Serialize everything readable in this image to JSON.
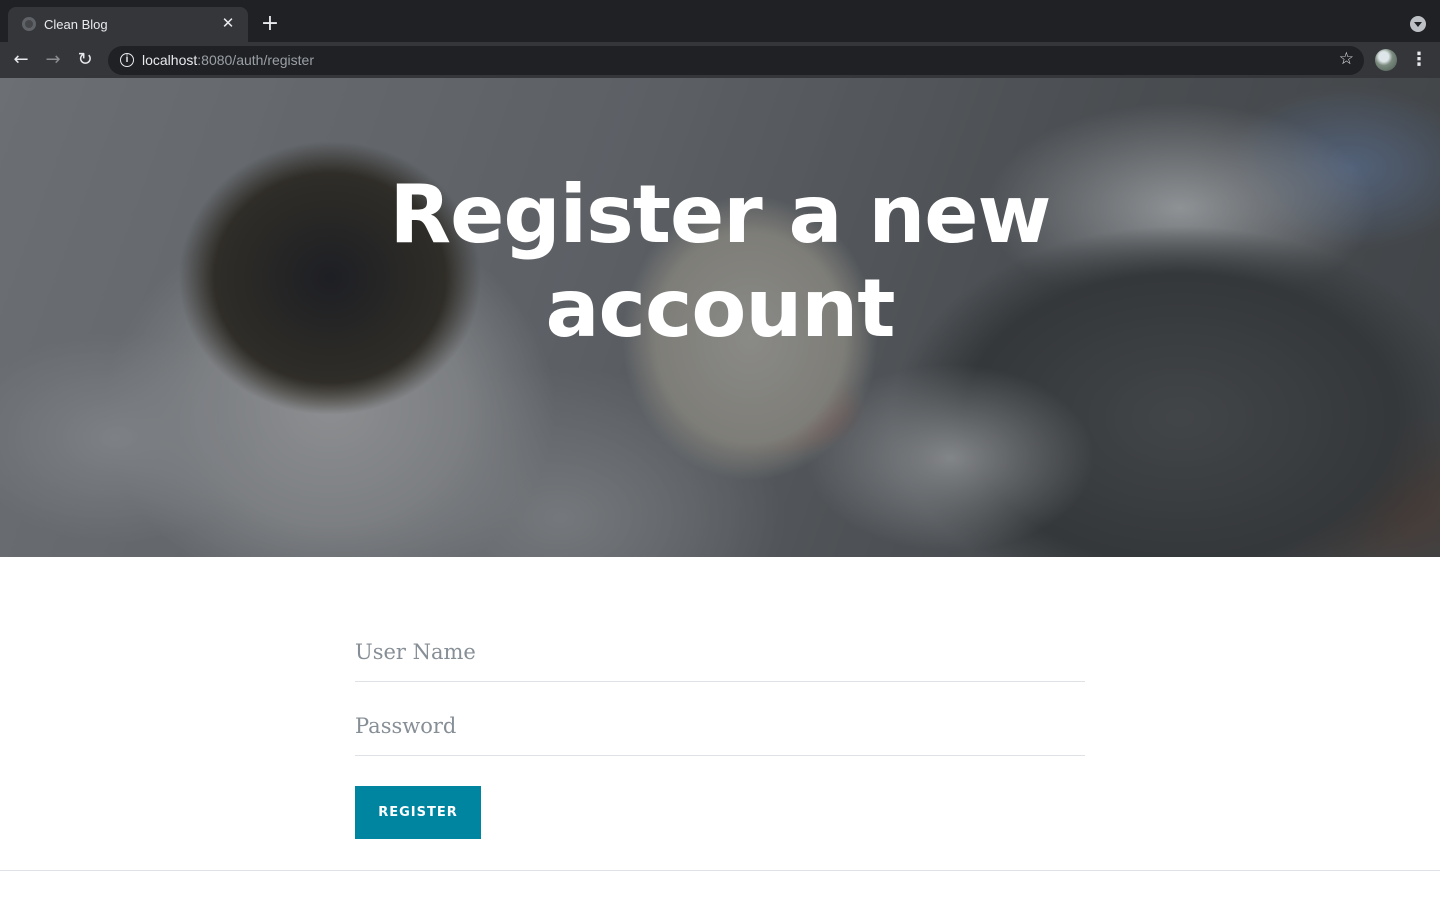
{
  "browser": {
    "tab_title": "Clean Blog",
    "tab_close": "✕",
    "new_tab": "+",
    "back": "←",
    "forward": "→",
    "reload": "↻",
    "info": "i",
    "url_host": "localhost",
    "url_rest": ":8080/auth/register",
    "star": "☆",
    "menu": "⋮"
  },
  "hero": {
    "title": "Register a new account"
  },
  "form": {
    "username_placeholder": "User Name",
    "password_placeholder": "Password",
    "submit_label": "Register"
  },
  "colors": {
    "accent": "#0085a1",
    "chrome_dark": "#202124",
    "chrome_toolbar": "#35363a"
  }
}
